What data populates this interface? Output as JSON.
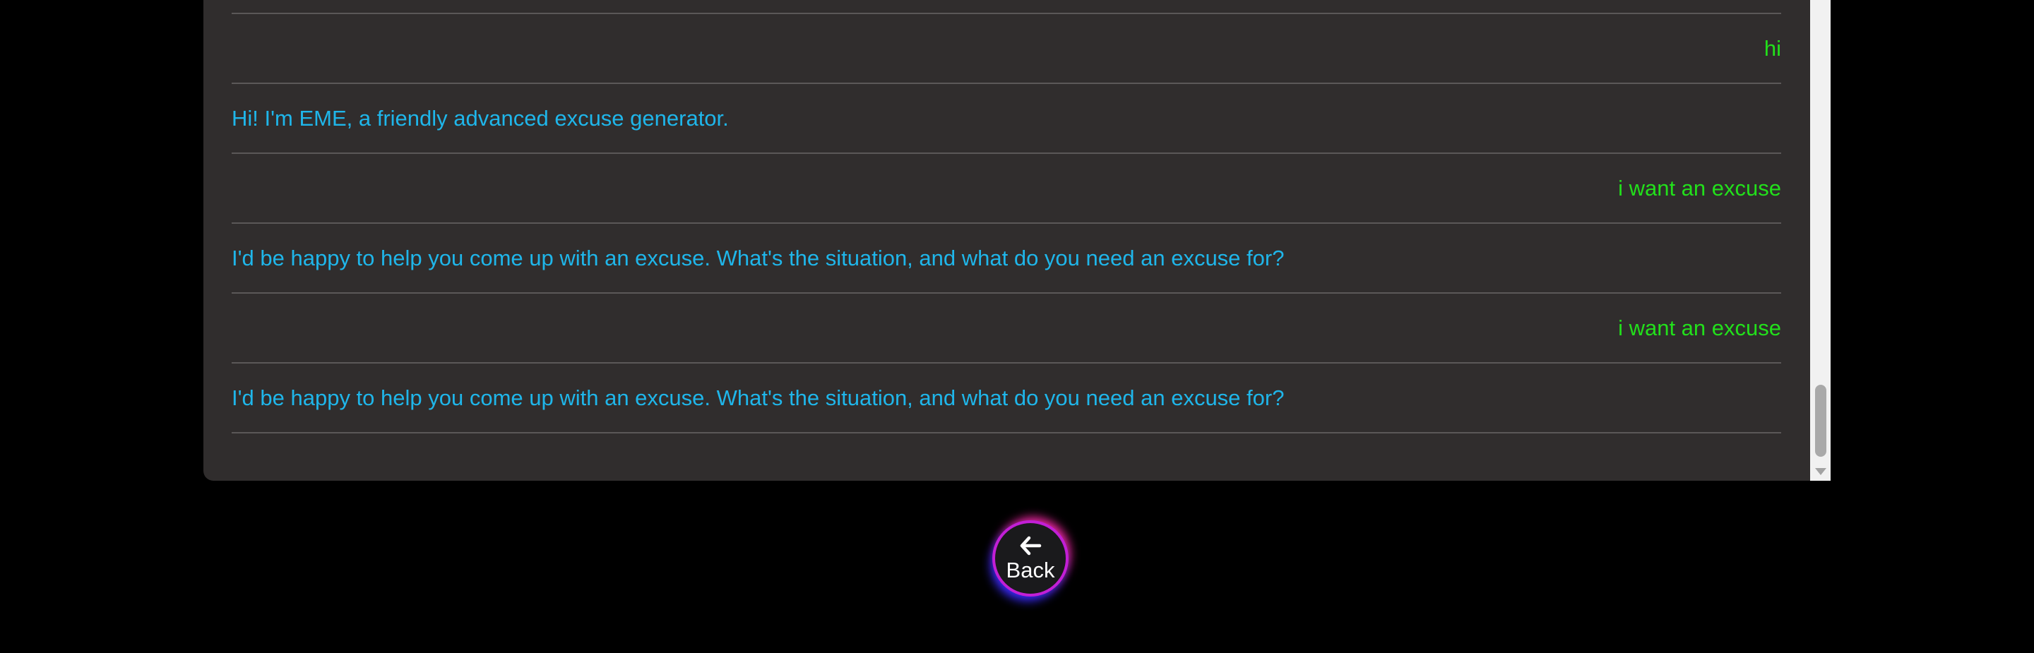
{
  "chat": {
    "messages": [
      {
        "role": "user",
        "text": "hi"
      },
      {
        "role": "bot",
        "text": "Hi! I'm EME, a friendly advanced excuse generator."
      },
      {
        "role": "user",
        "text": "i want an excuse"
      },
      {
        "role": "bot",
        "text": "I'd be happy to help you come up with an excuse. What's the situation, and what do you need an excuse for?"
      },
      {
        "role": "user",
        "text": "i want an excuse"
      },
      {
        "role": "bot",
        "text": "I'd be happy to help you come up with an excuse. What's the situation, and what do you need an excuse for?"
      }
    ]
  },
  "back_button": {
    "label": "Back",
    "icon": "arrow-left-icon"
  },
  "colors": {
    "background": "#000000",
    "panel": "#302d2d",
    "user_text": "#22e01b",
    "bot_text": "#1fb6ea",
    "divider": "#5b5858",
    "button_glow_pink": "#ff2aa8",
    "button_glow_blue": "#3a2bff"
  }
}
